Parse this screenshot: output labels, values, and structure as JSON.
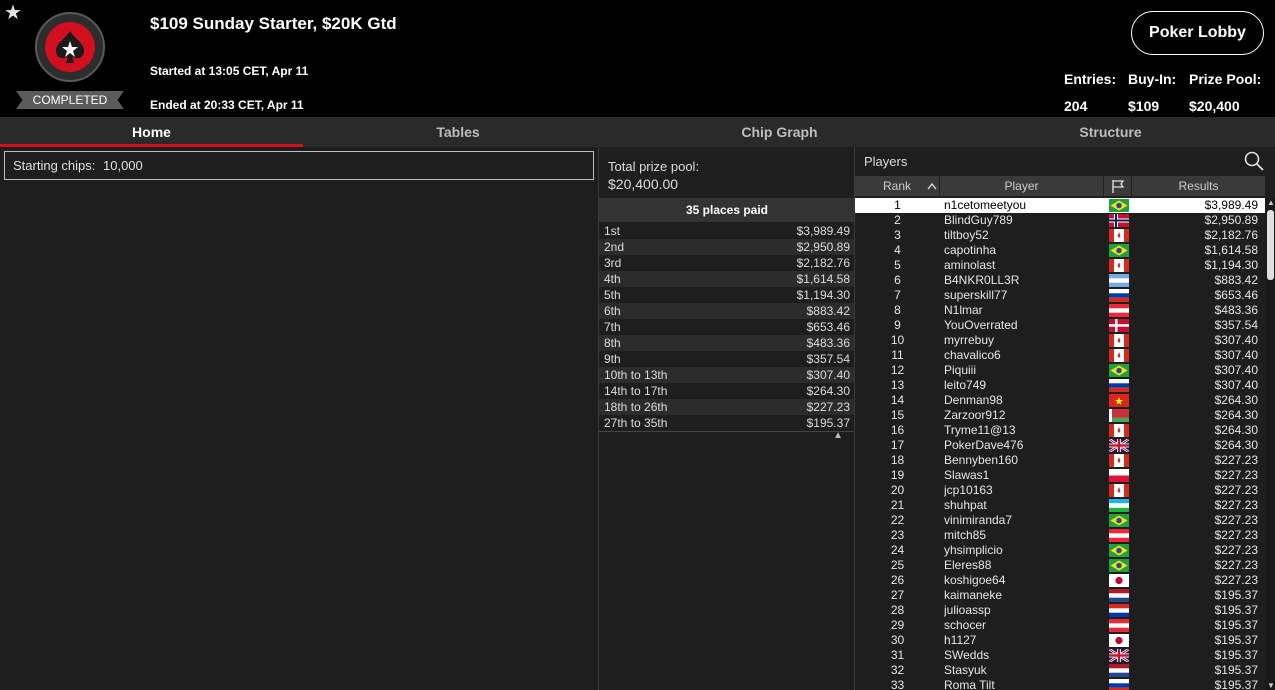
{
  "header": {
    "title": "$109 Sunday Starter, $20K Gtd",
    "started": "Started at 13:05 CET, Apr 11",
    "ended": "Ended at 20:33 CET, Apr 11",
    "status": "COMPLETED",
    "lobby_button": "Poker Lobby",
    "entries_label": "Entries:",
    "entries_value": "204",
    "buyin_label": "Buy-In:",
    "buyin_value": "$109",
    "prizepool_label": "Prize Pool:",
    "prizepool_value": "$20,400"
  },
  "tabs": [
    {
      "label": "Home",
      "active": true
    },
    {
      "label": "Tables",
      "active": false
    },
    {
      "label": "Chip Graph",
      "active": false
    },
    {
      "label": "Structure",
      "active": false
    }
  ],
  "home": {
    "starting_chips_label": "Starting chips:",
    "starting_chips_value": "10,000"
  },
  "prize": {
    "total_label": "Total prize pool:",
    "total_value": "$20,400.00",
    "places_paid": "35 places paid",
    "payouts": [
      {
        "place": "1st",
        "amount": "$3,989.49"
      },
      {
        "place": "2nd",
        "amount": "$2,950.89"
      },
      {
        "place": "3rd",
        "amount": "$2,182.76"
      },
      {
        "place": "4th",
        "amount": "$1,614.58"
      },
      {
        "place": "5th",
        "amount": "$1,194.30"
      },
      {
        "place": "6th",
        "amount": "$883.42"
      },
      {
        "place": "7th",
        "amount": "$653.46"
      },
      {
        "place": "8th",
        "amount": "$483.36"
      },
      {
        "place": "9th",
        "amount": "$357.54"
      },
      {
        "place": "10th to 13th",
        "amount": "$307.40"
      },
      {
        "place": "14th to 17th",
        "amount": "$264.30"
      },
      {
        "place": "18th to 26th",
        "amount": "$227.23"
      },
      {
        "place": "27th to 35th",
        "amount": "$195.37"
      }
    ]
  },
  "players": {
    "title": "Players",
    "columns": {
      "rank": "Rank",
      "player": "Player",
      "results": "Results"
    },
    "rows": [
      {
        "rank": "1",
        "name": "n1cetomeetyou",
        "flag": "br",
        "result": "$3,989.49"
      },
      {
        "rank": "2",
        "name": "BlindGuy789",
        "flag": "no",
        "result": "$2,950.89"
      },
      {
        "rank": "3",
        "name": "tiltboy52",
        "flag": "ca",
        "result": "$2,182.76"
      },
      {
        "rank": "4",
        "name": "capotinha",
        "flag": "br",
        "result": "$1,614.58"
      },
      {
        "rank": "5",
        "name": "aminolast",
        "flag": "ca",
        "result": "$1,194.30"
      },
      {
        "rank": "6",
        "name": "B4NKR0LL3R",
        "flag": "ar",
        "result": "$883.42"
      },
      {
        "rank": "7",
        "name": "superskill77",
        "flag": "ru",
        "result": "$653.46"
      },
      {
        "rank": "8",
        "name": "N1lmar",
        "flag": "at",
        "result": "$483.36"
      },
      {
        "rank": "9",
        "name": "YouOverrated",
        "flag": "dk",
        "result": "$357.54"
      },
      {
        "rank": "10",
        "name": "myrrebuy",
        "flag": "ca",
        "result": "$307.40"
      },
      {
        "rank": "11",
        "name": "chavalico6",
        "flag": "ca",
        "result": "$307.40"
      },
      {
        "rank": "12",
        "name": "Piquiii",
        "flag": "br",
        "result": "$307.40"
      },
      {
        "rank": "13",
        "name": "leito749",
        "flag": "ru",
        "result": "$307.40"
      },
      {
        "rank": "14",
        "name": "Denman98",
        "flag": "vn",
        "result": "$264.30"
      },
      {
        "rank": "15",
        "name": "Zarzoor912",
        "flag": "by",
        "result": "$264.30"
      },
      {
        "rank": "16",
        "name": "Tryme11@13",
        "flag": "ca",
        "result": "$264.30"
      },
      {
        "rank": "17",
        "name": "PokerDave476",
        "flag": "gb",
        "result": "$264.30"
      },
      {
        "rank": "18",
        "name": "Bennyben160",
        "flag": "ca",
        "result": "$227.23"
      },
      {
        "rank": "19",
        "name": "Slawas1",
        "flag": "pl",
        "result": "$227.23"
      },
      {
        "rank": "20",
        "name": "jcp10163",
        "flag": "ca",
        "result": "$227.23"
      },
      {
        "rank": "21",
        "name": "shuhpat",
        "flag": "uz",
        "result": "$227.23"
      },
      {
        "rank": "22",
        "name": "vinimiranda7",
        "flag": "br",
        "result": "$227.23"
      },
      {
        "rank": "23",
        "name": "mitch85",
        "flag": "at",
        "result": "$227.23"
      },
      {
        "rank": "24",
        "name": "yhsimplicio",
        "flag": "br",
        "result": "$227.23"
      },
      {
        "rank": "25",
        "name": "Eleres88",
        "flag": "br",
        "result": "$227.23"
      },
      {
        "rank": "26",
        "name": "koshigoe64",
        "flag": "jp",
        "result": "$227.23"
      },
      {
        "rank": "27",
        "name": "kaimaneke",
        "flag": "nl",
        "result": "$195.37"
      },
      {
        "rank": "28",
        "name": "julioassp",
        "flag": "py",
        "result": "$195.37"
      },
      {
        "rank": "29",
        "name": "schocer",
        "flag": "at",
        "result": "$195.37"
      },
      {
        "rank": "30",
        "name": "h1127",
        "flag": "jp",
        "result": "$195.37"
      },
      {
        "rank": "31",
        "name": "SWedds",
        "flag": "gb",
        "result": "$195.37"
      },
      {
        "rank": "32",
        "name": "Stasyuk",
        "flag": "nl",
        "result": "$195.37"
      },
      {
        "rank": "33",
        "name": "Roma Tilt",
        "flag": "ru",
        "result": "$195.37"
      }
    ]
  },
  "colors": {
    "accent": "#d10f1f",
    "header_bg": "#000000",
    "panel_bg": "#1e1e1e"
  }
}
